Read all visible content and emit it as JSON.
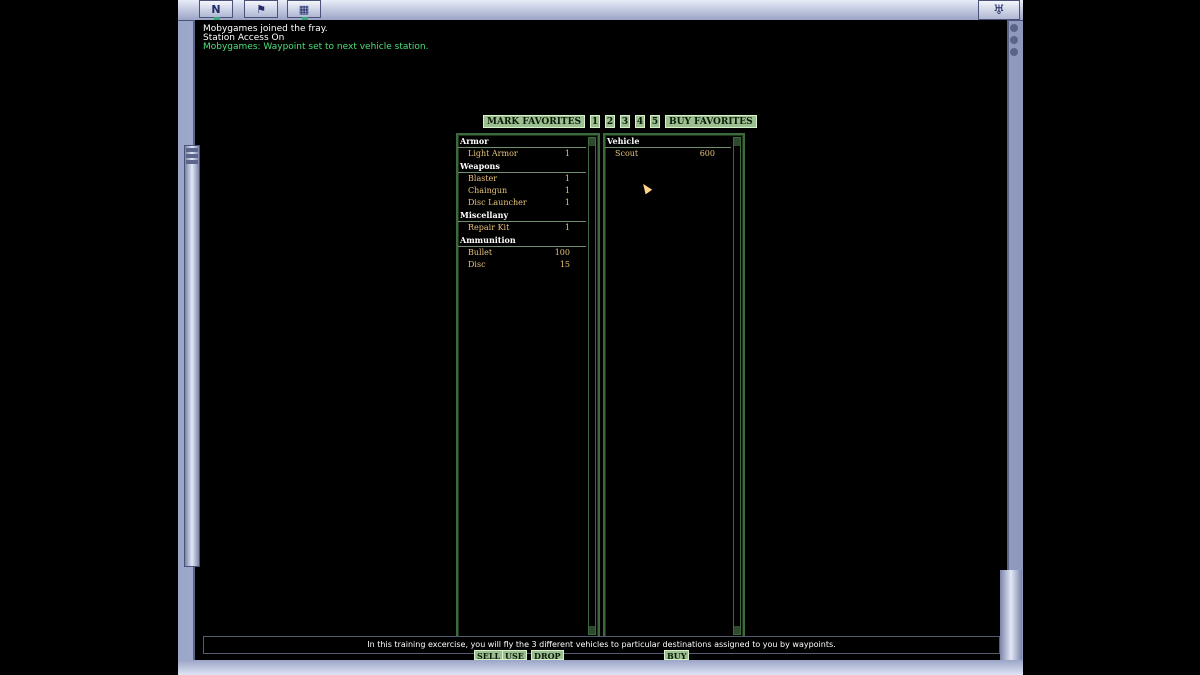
{
  "topbar": {
    "btn_compass": "N",
    "btn_flag": "⚑",
    "btn_map": "▦",
    "corner_icon": "♅"
  },
  "chat": {
    "line1": "Mobygames joined the fray.",
    "line2": "Station Access On",
    "line3": "Mobygames: Waypoint set to next vehicle station."
  },
  "favorites": {
    "mark_label": "MARK FAVORITES",
    "slots": [
      "1",
      "2",
      "3",
      "4",
      "5"
    ],
    "buy_label": "BUY FAVORITES"
  },
  "inventory": {
    "categories": [
      {
        "name": "Armor",
        "items": [
          {
            "name": "Light Armor",
            "qty": "1"
          }
        ]
      },
      {
        "name": "Weapons",
        "items": [
          {
            "name": "Blaster",
            "qty": "1"
          },
          {
            "name": "Chaingun",
            "qty": "1"
          },
          {
            "name": "Disc Launcher",
            "qty": "1"
          }
        ]
      },
      {
        "name": "Miscellany",
        "items": [
          {
            "name": "Repair Kit",
            "qty": "1"
          }
        ]
      },
      {
        "name": "Ammunition",
        "items": [
          {
            "name": "Bullet",
            "qty": "100"
          },
          {
            "name": "Disc",
            "qty": "15"
          }
        ]
      }
    ]
  },
  "vehicles": {
    "category": "Vehicle",
    "items": [
      {
        "name": "Scout",
        "qty": "600"
      }
    ]
  },
  "hint": {
    "text": "In this training excercise, you will fly the 3 different vehicles to particular destinations assigned to you by waypoints.",
    "sell": "SELL",
    "use": "USE",
    "drop": "DROP",
    "buy": "BUY"
  },
  "colors": {
    "panel_border": "#3d6a3d",
    "item_text": "#e8c27a",
    "chat_green": "#4ce07a",
    "button_bg": "#9bbf8e"
  }
}
